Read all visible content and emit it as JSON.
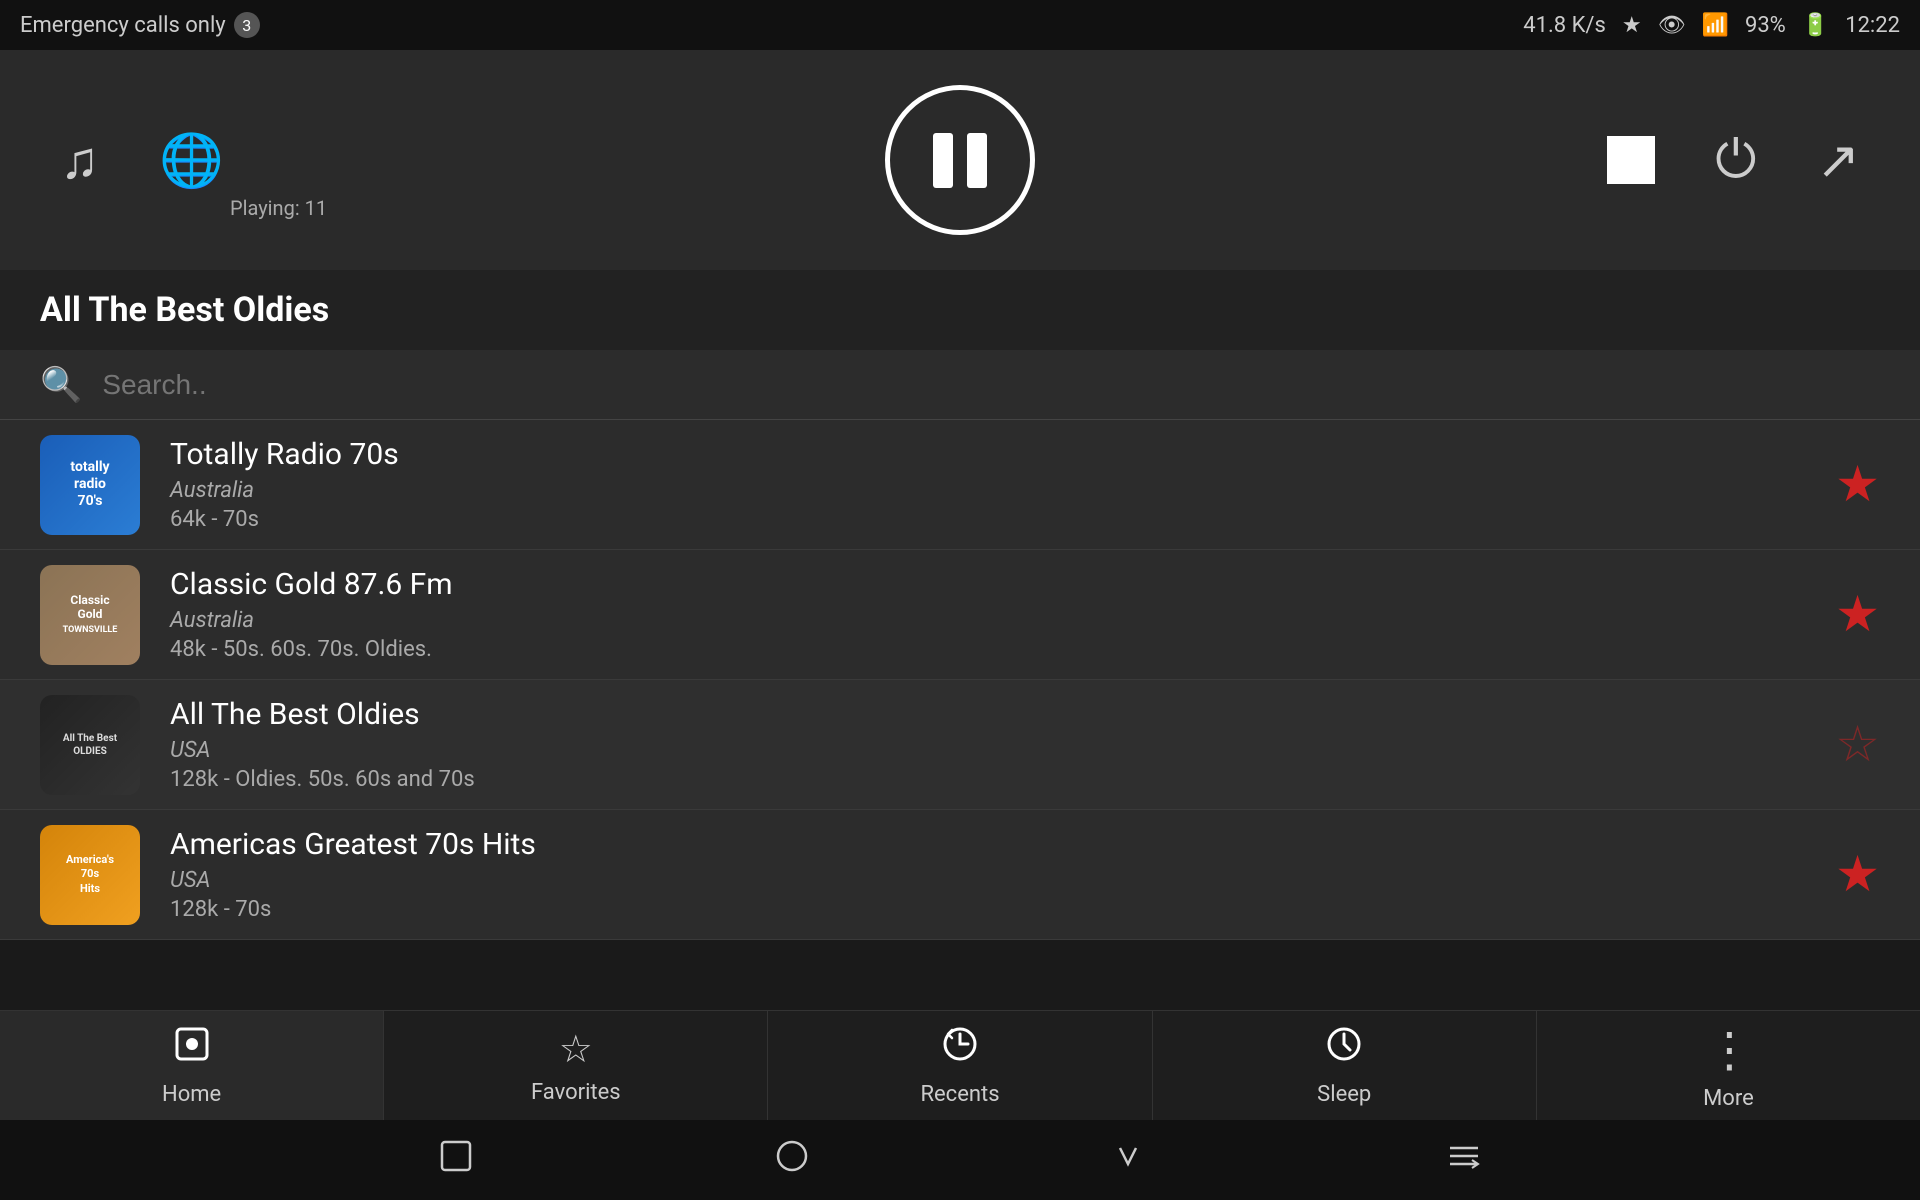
{
  "statusBar": {
    "emergencyText": "Emergency calls only",
    "badge": "3",
    "networkSpeed": "41.8 K/s",
    "batteryPercent": "93%",
    "time": "12:22"
  },
  "player": {
    "playingLabel": "Playing: 11",
    "currentStation": "All The Best Oldies"
  },
  "search": {
    "placeholder": "Search.."
  },
  "stations": [
    {
      "name": "Totally Radio 70s",
      "country": "Australia",
      "bitrate": "64k - 70s",
      "logoText": "totally\nradio\n70's",
      "logoClass": "logo-70s",
      "favorited": true
    },
    {
      "name": "Classic Gold 87.6 Fm",
      "country": "Australia",
      "bitrate": "48k - 50s. 60s. 70s. Oldies.",
      "logoText": "Classic\nGold\nTOWNSVILLE",
      "logoClass": "logo-classic",
      "favorited": true
    },
    {
      "name": "All The Best Oldies",
      "country": "USA",
      "bitrate": "128k - Oldies. 50s. 60s and 70s",
      "logoText": "All The Best\nOLDIES",
      "logoClass": "logo-oldies",
      "favorited": false
    },
    {
      "name": "Americas Greatest 70s Hits",
      "country": "USA",
      "bitrate": "128k - 70s",
      "logoText": "America's\n70s\nHits",
      "logoClass": "logo-americas",
      "favorited": true
    }
  ],
  "bottomNav": [
    {
      "id": "home",
      "label": "Home",
      "icon": "⊡",
      "active": true
    },
    {
      "id": "favorites",
      "label": "Favorites",
      "icon": "☆",
      "active": false
    },
    {
      "id": "recents",
      "label": "Recents",
      "icon": "⟳",
      "active": false
    },
    {
      "id": "sleep",
      "label": "Sleep",
      "icon": "🕐",
      "active": false
    },
    {
      "id": "more",
      "label": "More",
      "icon": "⋮",
      "active": false
    }
  ]
}
